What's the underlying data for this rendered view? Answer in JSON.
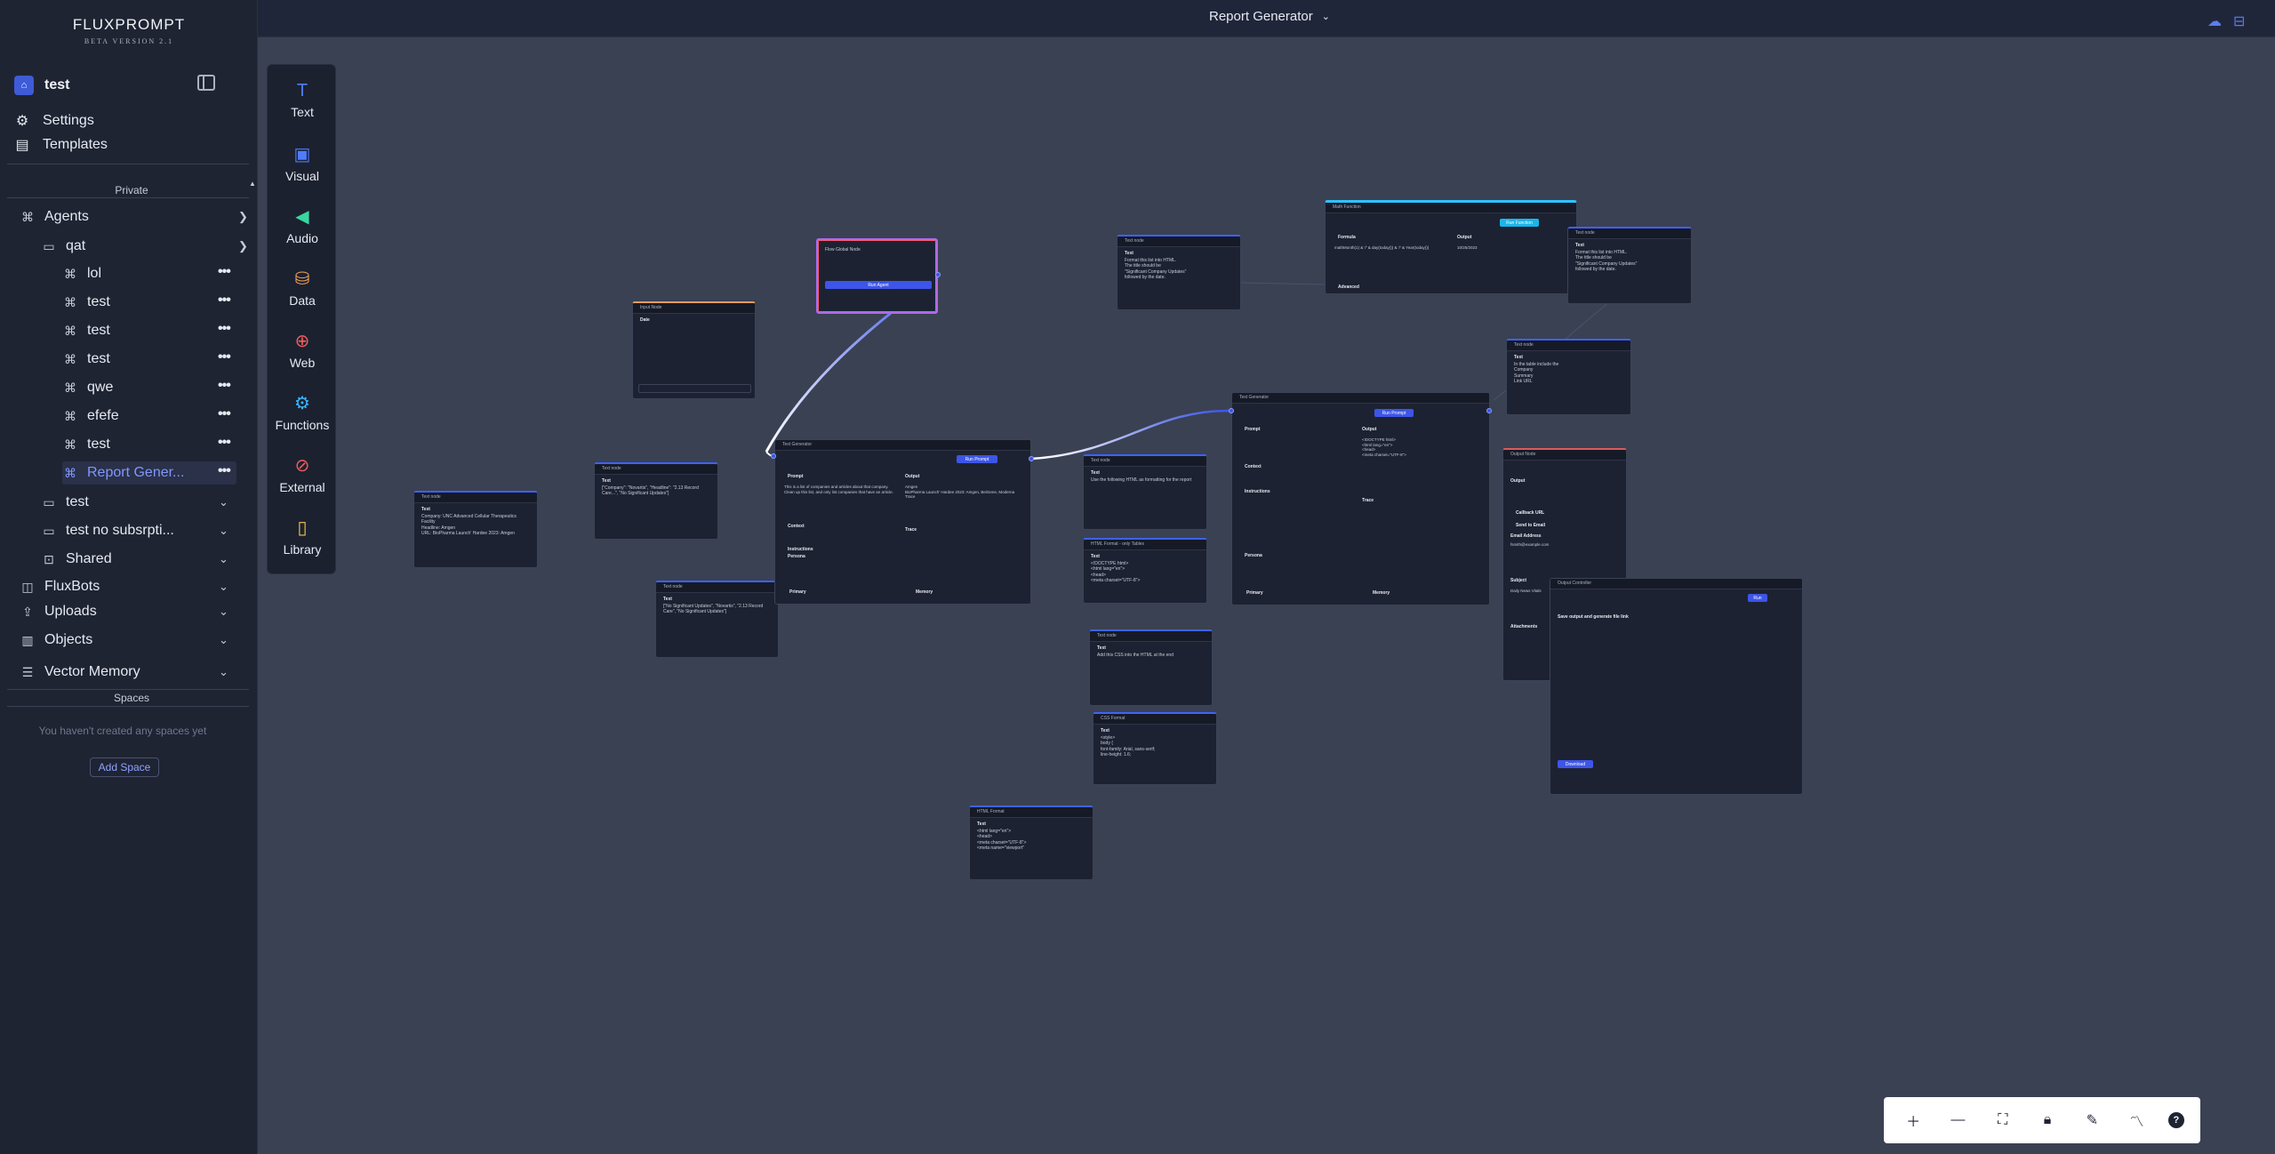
{
  "app": {
    "logo": "FLUXPROMPT",
    "version": "BETA VERSION 2.1"
  },
  "workspace": {
    "name": "test"
  },
  "nav": {
    "settings": "Settings",
    "templates": "Templates"
  },
  "sidebar": {
    "private_label": "Private",
    "agents": "Agents",
    "folder_qat": "qat",
    "qat_items": [
      "lol",
      "test",
      "test",
      "test",
      "qwe",
      "efefe",
      "test",
      "Report Gener..."
    ],
    "folder_test": "test",
    "folder_test_no_sub": "test no subsrpti...",
    "shared": "Shared",
    "fluxbots": "FluxBots",
    "uploads": "Uploads",
    "objects": "Objects",
    "vector_memory": "Vector Memory",
    "spaces_label": "Spaces",
    "spaces_empty": "You haven't created any spaces yet",
    "add_space": "Add Space"
  },
  "topbar": {
    "title": "Report Generator"
  },
  "palette": [
    {
      "label": "Text",
      "icon": "text-icon",
      "color": "#4f7cff",
      "glyph": "T"
    },
    {
      "label": "Visual",
      "icon": "image-icon",
      "color": "#4f7cff",
      "glyph": "▣"
    },
    {
      "label": "Audio",
      "icon": "speaker-icon",
      "color": "#3ad6a0",
      "glyph": "◀"
    },
    {
      "label": "Data",
      "icon": "database-icon",
      "color": "#f0a25a",
      "glyph": "⛁"
    },
    {
      "label": "Web",
      "icon": "globe-icon",
      "color": "#ef5d5d",
      "glyph": "⊕"
    },
    {
      "label": "Functions",
      "icon": "gear-icon",
      "color": "#38b6ff",
      "glyph": "⚙"
    },
    {
      "label": "External",
      "icon": "plug-icon",
      "color": "#ef5d5d",
      "glyph": "⊘"
    },
    {
      "label": "Library",
      "icon": "book-icon",
      "color": "#f0c24a",
      "glyph": "▯"
    }
  ],
  "nodes": {
    "input_node": {
      "title": "Input Node",
      "label": "Date"
    },
    "global_node": {
      "title": "Flow Global Node",
      "button": "Run Agent"
    },
    "text_node_top": {
      "title": "Text node",
      "label": "Text",
      "body": "Format this list into HTML.\nThe title should be\n\"Significant Company Updates\"\nfollowed by the date."
    },
    "math_function": {
      "title": "Math Function",
      "formula_label": "Formula",
      "formula": "mathMonth(1) & '/' & day(today()) & '/' & Year(today())",
      "output_label": "Output",
      "output": "10/25/2023",
      "advanced": "Advanced",
      "run": "Run Function"
    },
    "text_node_right": {
      "title": "Text node",
      "label": "Text",
      "body": "Format this list into HTML.\nThe title should be\n\"Significant Company Updates\"\nfollowed by the date."
    },
    "text_node_table": {
      "title": "Text node",
      "label": "Text",
      "body": "In the table include the\nCompany\nSummary\nLink URL"
    },
    "text_node_left": {
      "title": "Text node",
      "label": "Text",
      "body": "Company: UNC Advanced Cellular Therapeutics Facility\nHeadline: Amgen\nURL: BioPharma Launch' Hardee 2023: Amgen"
    },
    "text_node_mid": {
      "title": "Text node",
      "label": "Text",
      "body": "[\"Company\": \"Novartis\", \"Headline\": \"2.13 Record Care...\", \"No Significant Updates\"]"
    },
    "text_node_lower": {
      "title": "Text node",
      "label": "Text",
      "body": "[\"No Significant Updates\", \"Novartis\", \"2.13 Record Care\", \"No Significant Updates\"]"
    },
    "text_gen_1": {
      "title": "Text Generator",
      "run": "Run Prompt",
      "prompt_label": "Prompt",
      "prompt": "This is a list of companies and articles about that company.\nClean up this list, and only list companies that have an article.",
      "output_label": "Output",
      "output": "Amgen\nBioPharma Launch' Hardee 2023: Amgen, BeiGene, Moderna\nTrace",
      "context": "Context",
      "instructions": "Instructions",
      "persona": "Persona",
      "primary": "Primary",
      "memory": "Memory",
      "trace": "Trace"
    },
    "text_node_html": {
      "title": "Text node",
      "label": "Text",
      "body": "Use the following HTML as formatting for the report"
    },
    "html_format_tables": {
      "title": "HTML Format - only Tables",
      "label": "Text",
      "body": "<!DOCTYPE html>\n<html lang=\"en\">\n<head>\n<meta charset=\"UTF-8\">"
    },
    "text_node_css": {
      "title": "Text node",
      "label": "Text",
      "body": "Add this CSS into the HTML at the end"
    },
    "css_format": {
      "title": "CSS Format",
      "label": "Text",
      "body": "<style>\nbody {\n font-family: Arial, sans-serif;\n line-height: 1.6;"
    },
    "html_format": {
      "title": "HTML Format",
      "label": "Text",
      "body": "<html lang=\"en\">\n<head>\n<meta charset=\"UTF-8\">\n<meta name=\"viewport\""
    },
    "text_gen_2": {
      "title": "Text Generator",
      "run": "Run Prompt",
      "prompt_label": "Prompt",
      "output_label": "Output",
      "output": "<!DOCTYPE html>\n<html lang=\"en\">\n<head>\n<meta charset=\"UTF-8\">",
      "context": "Context",
      "instructions": "Instructions",
      "persona": "Persona",
      "primary": "Primary",
      "memory": "Memory",
      "trace": "Trace"
    },
    "output_node": {
      "title": "Output Node",
      "output_label": "Output",
      "callback": "Callback URL",
      "send_email": "Send to Email",
      "email_label": "Email Address",
      "email": "fsmith@example.com",
      "subject_label": "Subject",
      "subject": "Daily News Vitals",
      "attachments": "Attachments"
    },
    "output_controller": {
      "title": "Output Controller",
      "run": "Run",
      "toggle_label": "Save output and generate file link",
      "download": "Download"
    }
  }
}
